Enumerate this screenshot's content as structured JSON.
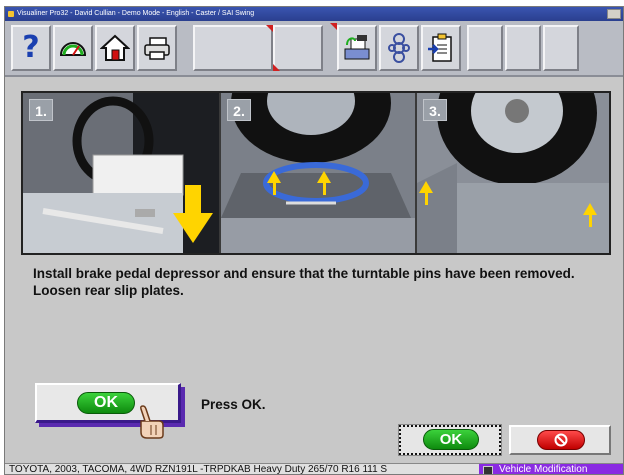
{
  "window": {
    "title": "Visualiner Pro32 - David Cullian - Demo Mode - English  -  Caster / SAI Swing"
  },
  "toolbar": {
    "buttons": [
      {
        "icon": "question-mark-icon",
        "glyph": "?"
      },
      {
        "icon": "gauge-icon"
      },
      {
        "icon": "home-icon"
      },
      {
        "icon": "printer-icon"
      },
      {
        "icon": "empty-slot"
      },
      {
        "icon": "empty-slot"
      },
      {
        "icon": "empty-slot"
      },
      {
        "icon": "vehicle-lift-icon"
      },
      {
        "icon": "helix-spring-icon"
      },
      {
        "icon": "clipboard-arrow-icon"
      }
    ]
  },
  "steps": [
    {
      "number": "1."
    },
    {
      "number": "2."
    },
    {
      "number": "3."
    }
  ],
  "instruction": "Install brake pedal depressor and ensure that the turntable pins have been removed. Loosen rear slip plates.",
  "ok_button": {
    "label": "OK"
  },
  "press_ok_text": "Press OK.",
  "dialog_buttons": {
    "ok_label": "OK"
  },
  "status": {
    "vehicle": "TOYOTA, 2003, TACOMA, 4WD RZN191L -TRPDKAB Heavy Duty 265/70 R16 111 S",
    "mode": "Vehicle Modification"
  },
  "colors": {
    "ok_green": "#1fae1f",
    "cancel_red": "#e01010",
    "mode_purple": "#8a2be2",
    "arrow_yellow": "#ffd400"
  }
}
